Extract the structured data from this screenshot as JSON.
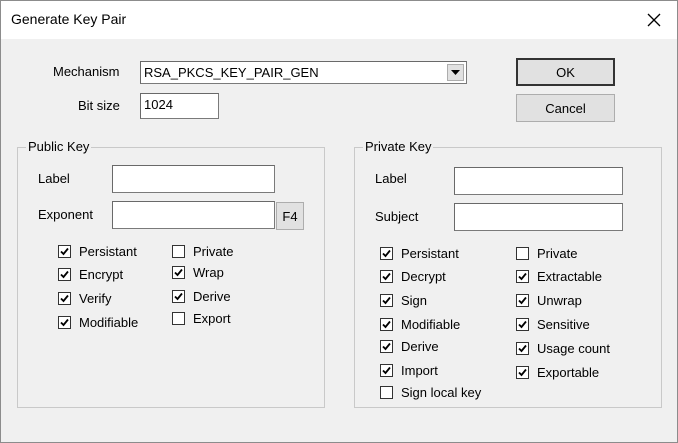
{
  "window": {
    "title": "Generate Key Pair"
  },
  "mechanism": {
    "label": "Mechanism",
    "value": "RSA_PKCS_KEY_PAIR_GEN"
  },
  "bitsize": {
    "label": "Bit size",
    "value": "1024"
  },
  "buttons": {
    "ok": "OK",
    "cancel": "Cancel",
    "f4": "F4"
  },
  "public_key": {
    "title": "Public Key",
    "label_field": {
      "label": "Label",
      "value": ""
    },
    "exponent_field": {
      "label": "Exponent",
      "value": ""
    },
    "checkboxes": [
      {
        "label": "Persistant",
        "checked": true
      },
      {
        "label": "Encrypt",
        "checked": true
      },
      {
        "label": "Verify",
        "checked": true
      },
      {
        "label": "Modifiable",
        "checked": true
      },
      {
        "label": "Private",
        "checked": false
      },
      {
        "label": "Wrap",
        "checked": true
      },
      {
        "label": "Derive",
        "checked": true
      },
      {
        "label": "Export",
        "checked": false
      }
    ]
  },
  "private_key": {
    "title": "Private Key",
    "label_field": {
      "label": "Label",
      "value": ""
    },
    "subject_field": {
      "label": "Subject",
      "value": ""
    },
    "checkboxes": [
      {
        "label": "Persistant",
        "checked": true
      },
      {
        "label": "Decrypt",
        "checked": true
      },
      {
        "label": "Sign",
        "checked": true
      },
      {
        "label": "Modifiable",
        "checked": true
      },
      {
        "label": "Derive",
        "checked": true
      },
      {
        "label": "Import",
        "checked": true
      },
      {
        "label": "Sign local key",
        "checked": false
      },
      {
        "label": "Private",
        "checked": false
      },
      {
        "label": "Extractable",
        "checked": true
      },
      {
        "label": "Unwrap",
        "checked": true
      },
      {
        "label": "Sensitive",
        "checked": true
      },
      {
        "label": "Usage count",
        "checked": true
      },
      {
        "label": "Exportable",
        "checked": true
      }
    ]
  }
}
